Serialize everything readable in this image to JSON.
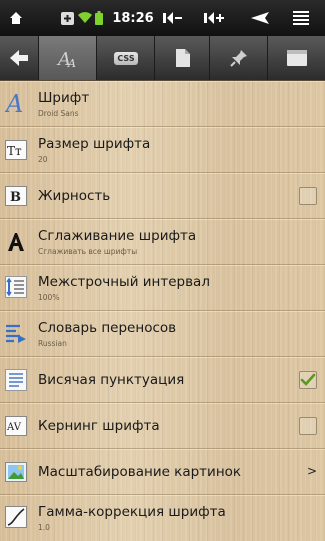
{
  "status_bar": {
    "time": "18:26"
  },
  "toolbar": {
    "buttons": [
      {
        "icon": "back-arrow-icon"
      },
      {
        "icon": "font-icon",
        "active": true
      },
      {
        "icon": "css-icon",
        "label": "CSS"
      },
      {
        "icon": "page-icon"
      },
      {
        "icon": "pin-icon"
      },
      {
        "icon": "window-icon"
      }
    ]
  },
  "settings": {
    "font": {
      "title": "Шрифт",
      "value": "Droid Sans"
    },
    "font_size": {
      "title": "Размер шрифта",
      "value": "20"
    },
    "bold": {
      "title": "Жирность",
      "checked": false
    },
    "antialiasing": {
      "title": "Сглаживание шрифта",
      "value": "Сглаживать все шрифты"
    },
    "line_spacing": {
      "title": "Межстрочный интервал",
      "value": "100%"
    },
    "hyphenation": {
      "title": "Словарь переносов",
      "value": "Russian"
    },
    "hanging_punct": {
      "title": "Висячая пунктуация",
      "checked": true
    },
    "kerning": {
      "title": "Кернинг шрифта",
      "checked": false
    },
    "image_scaling": {
      "title": "Масштабирование картинок",
      "chevron": ">"
    },
    "gamma": {
      "title": "Гамма-коррекция шрифта",
      "value": "1.0"
    }
  },
  "colors": {
    "check_green": "#5a9a1e",
    "toolbar_dark": "#2c2c2c"
  }
}
